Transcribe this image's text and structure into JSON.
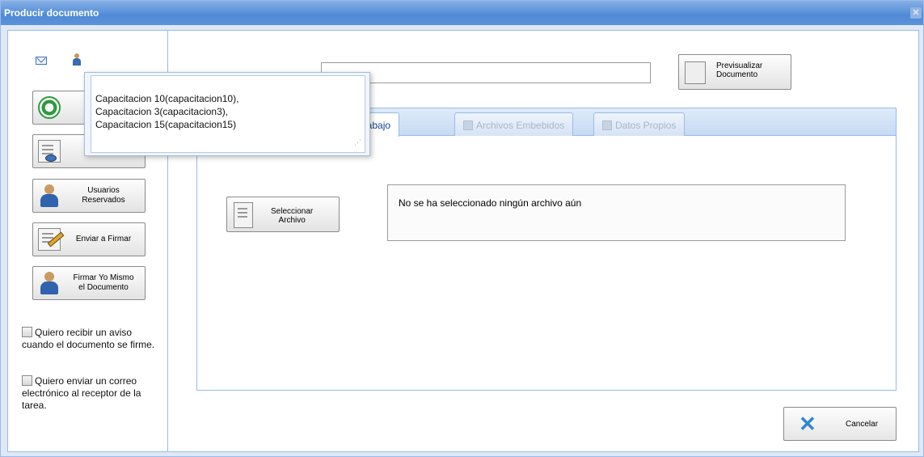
{
  "window": {
    "title": "Producir documento"
  },
  "left": {
    "buttons": [
      {
        "label": "",
        "icon": "refresh-icon"
      },
      {
        "label": "",
        "icon": "view-document-icon"
      },
      {
        "label": "Usuarios\nReservados",
        "icon": "user-icon"
      },
      {
        "label": "Enviar a Firmar",
        "icon": "sign-pen-icon"
      },
      {
        "label": "Firmar Yo Mismo\nel Documento",
        "icon": "self-sign-icon"
      }
    ],
    "checkboxes": [
      {
        "label": "Quiero recibir un aviso cuando el documento se firme.",
        "checked": false
      },
      {
        "label": "Quiero enviar un correo electrónico al receptor de la tarea.",
        "checked": false
      }
    ]
  },
  "main": {
    "preview_button": "Previsualizar\nDocumento",
    "tabs": [
      {
        "label": "e Trabajo",
        "active": true
      },
      {
        "label": "Archivos Embebidos",
        "active": false
      },
      {
        "label": "Datos Propios",
        "active": false
      }
    ],
    "select_button": "Seleccionar\nArchivo",
    "file_status": "No se ha seleccionado ningún archivo aún",
    "cancel_button": "Cancelar"
  },
  "popup": {
    "text": "Capacitacion 10(capacitacion10),\nCapacitacion 3(capacitacion3),\nCapacitacion 15(capacitacion15)"
  }
}
